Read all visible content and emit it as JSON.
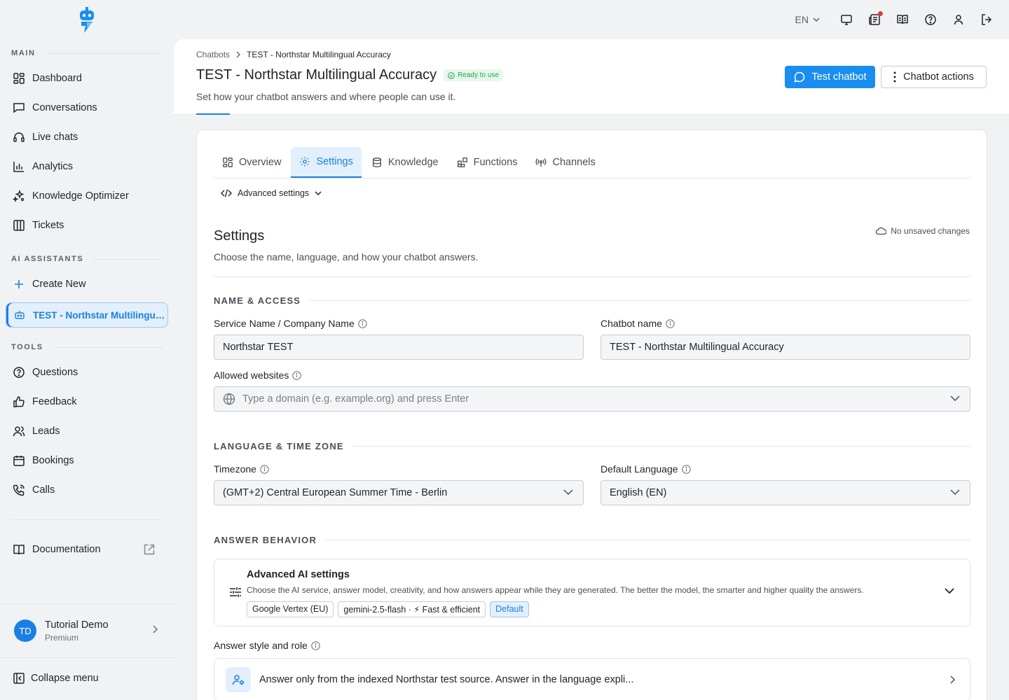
{
  "sidebar": {
    "main_label": "MAIN",
    "main_items": [
      {
        "label": "Dashboard",
        "icon": "dashboard-icon"
      },
      {
        "label": "Conversations",
        "icon": "chat-icon"
      },
      {
        "label": "Live chats",
        "icon": "headset-icon"
      },
      {
        "label": "Analytics",
        "icon": "bar-chart-icon"
      },
      {
        "label": "Knowledge Optimizer",
        "icon": "sparkle-icon"
      },
      {
        "label": "Tickets",
        "icon": "columns-icon"
      }
    ],
    "ai_label": "AI ASSISTANTS",
    "create_new": "Create New",
    "active_bot": "TEST - Northstar Multilingual Accuracy",
    "tools_label": "TOOLS",
    "tools_items": [
      {
        "label": "Questions",
        "icon": "question-icon"
      },
      {
        "label": "Feedback",
        "icon": "thumbs-up-icon"
      },
      {
        "label": "Leads",
        "icon": "users-icon"
      },
      {
        "label": "Bookings",
        "icon": "calendar-icon"
      },
      {
        "label": "Calls",
        "icon": "phone-icon"
      }
    ],
    "documentation": "Documentation",
    "profile": {
      "initials": "TD",
      "name": "Tutorial Demo",
      "plan": "Premium"
    },
    "collapse": "Collapse menu"
  },
  "topbar": {
    "language": "EN"
  },
  "header": {
    "breadcrumb_root": "Chatbots",
    "breadcrumb_current": "TEST - Northstar Multilingual Accuracy",
    "title": "TEST - Northstar Multilingual Accuracy",
    "status": "Ready to use",
    "subtitle": "Set how your chatbot answers and where people can use it.",
    "test_button": "Test chatbot",
    "actions_button": "Chatbot actions"
  },
  "tabs": [
    "Overview",
    "Settings",
    "Knowledge",
    "Functions",
    "Channels"
  ],
  "active_tab": "Settings",
  "advanced_settings": "Advanced settings",
  "settings": {
    "title": "Settings",
    "description": "Choose the name, language, and how your chatbot answers.",
    "save_status": "No unsaved changes",
    "name_access": {
      "heading": "NAME & ACCESS",
      "service_label": "Service Name / Company Name",
      "service_value": "Northstar TEST",
      "chatbot_label": "Chatbot name",
      "chatbot_value": "TEST - Northstar Multilingual Accuracy",
      "websites_label": "Allowed websites",
      "websites_placeholder": "Type a domain (e.g. example.org) and press Enter"
    },
    "language_tz": {
      "heading": "LANGUAGE & TIME ZONE",
      "timezone_label": "Timezone",
      "timezone_value": "(GMT+2) Central European Summer Time - Berlin",
      "language_label": "Default Language",
      "language_value": "English (EN)"
    },
    "answer_behavior": {
      "heading": "ANSWER BEHAVIOR",
      "ai_title": "Advanced AI settings",
      "ai_desc": "Choose the AI service, answer model, creativity, and how answers appear while they are generated. The better the model, the smarter and higher quality the answers.",
      "chip_provider": "Google Vertex (EU)",
      "chip_model": "gemini-2.5-flash · ⚡ Fast & efficient",
      "chip_default": "Default",
      "style_label": "Answer style and role",
      "style_text": "Answer only from the indexed Northstar test source. Answer in the language expli..."
    }
  },
  "colors": {
    "accent": "#1a7fe3",
    "button": "#1a8ef0",
    "ready": "#1ea64a"
  }
}
